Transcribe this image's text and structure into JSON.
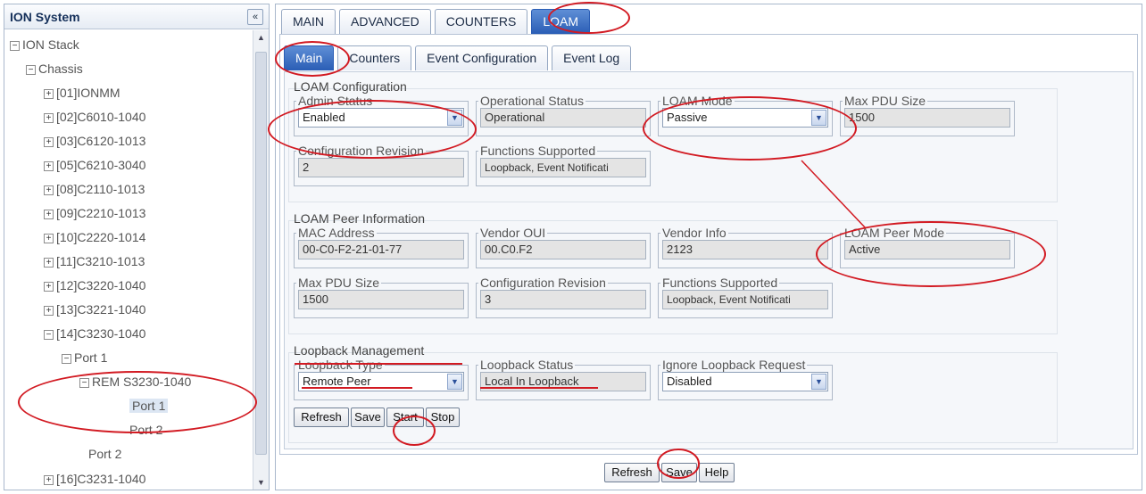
{
  "left_panel": {
    "title": "ION System",
    "collapse_icon": "«",
    "tree": [
      {
        "label": "ION Stack",
        "expander": "−"
      },
      {
        "label": "Chassis",
        "expander": "−"
      },
      {
        "label": "[01]IONMM",
        "expander": "+"
      },
      {
        "label": "[02]C6010-1040",
        "expander": "+"
      },
      {
        "label": "[03]C6120-1013",
        "expander": "+"
      },
      {
        "label": "[05]C6210-3040",
        "expander": "+"
      },
      {
        "label": "[08]C2110-1013",
        "expander": "+"
      },
      {
        "label": "[09]C2210-1013",
        "expander": "+"
      },
      {
        "label": "[10]C2220-1014",
        "expander": "+"
      },
      {
        "label": "[11]C3210-1013",
        "expander": "+"
      },
      {
        "label": "[12]C3220-1040",
        "expander": "+"
      },
      {
        "label": "[13]C3221-1040",
        "expander": "+"
      },
      {
        "label": "[14]C3230-1040",
        "expander": "−"
      },
      {
        "label": "Port 1",
        "expander": "−"
      },
      {
        "label": "REM S3230-1040",
        "expander": "−"
      },
      {
        "label": "Port 1",
        "expander": ""
      },
      {
        "label": "Port 2",
        "expander": ""
      },
      {
        "label": "Port 2",
        "expander": ""
      },
      {
        "label": "[16]C3231-1040",
        "expander": "+"
      }
    ]
  },
  "main_tabs": [
    "MAIN",
    "ADVANCED",
    "COUNTERS",
    "LOAM"
  ],
  "sub_tabs": [
    "Main",
    "Counters",
    "Event Configuration",
    "Event Log"
  ],
  "loam_config": {
    "title": "LOAM Configuration",
    "admin_status": {
      "label": "Admin Status",
      "value": "Enabled"
    },
    "operational_status": {
      "label": "Operational Status",
      "value": "Operational"
    },
    "loam_mode": {
      "label": "LOAM Mode",
      "value": "Passive"
    },
    "max_pdu": {
      "label": "Max PDU Size",
      "value": "1500"
    },
    "config_revision": {
      "label": "Configuration Revision",
      "value": "2"
    },
    "functions": {
      "label": "Functions Supported",
      "value": "Loopback, Event Notificati"
    }
  },
  "loam_peer": {
    "title": "LOAM Peer Information",
    "mac": {
      "label": "MAC Address",
      "value": "00-C0-F2-21-01-77"
    },
    "vendor_oui": {
      "label": "Vendor OUI",
      "value": "00.C0.F2"
    },
    "vendor_info": {
      "label": "Vendor Info",
      "value": "2123"
    },
    "peer_mode": {
      "label": "LOAM Peer Mode",
      "value": "Active"
    },
    "max_pdu": {
      "label": "Max PDU Size",
      "value": "1500"
    },
    "config_revision": {
      "label": "Configuration Revision",
      "value": "3"
    },
    "functions": {
      "label": "Functions Supported",
      "value": "Loopback, Event Notificati"
    }
  },
  "loopback": {
    "title": "Loopback Management",
    "type": {
      "label": "Loopback Type",
      "value": "Remote Peer"
    },
    "status": {
      "label": "Loopback Status",
      "value": "Local In Loopback"
    },
    "ignore": {
      "label": "Ignore Loopback Request",
      "value": "Disabled"
    },
    "buttons": {
      "refresh": "Refresh",
      "save": "Save",
      "start": "Start",
      "stop": "Stop"
    }
  },
  "bottom_buttons": {
    "refresh": "Refresh",
    "save": "Save",
    "help": "Help"
  },
  "dropdown_icon": "▼",
  "colors": {
    "active_tab": "#2a5db5",
    "annotation": "#d21a22"
  }
}
